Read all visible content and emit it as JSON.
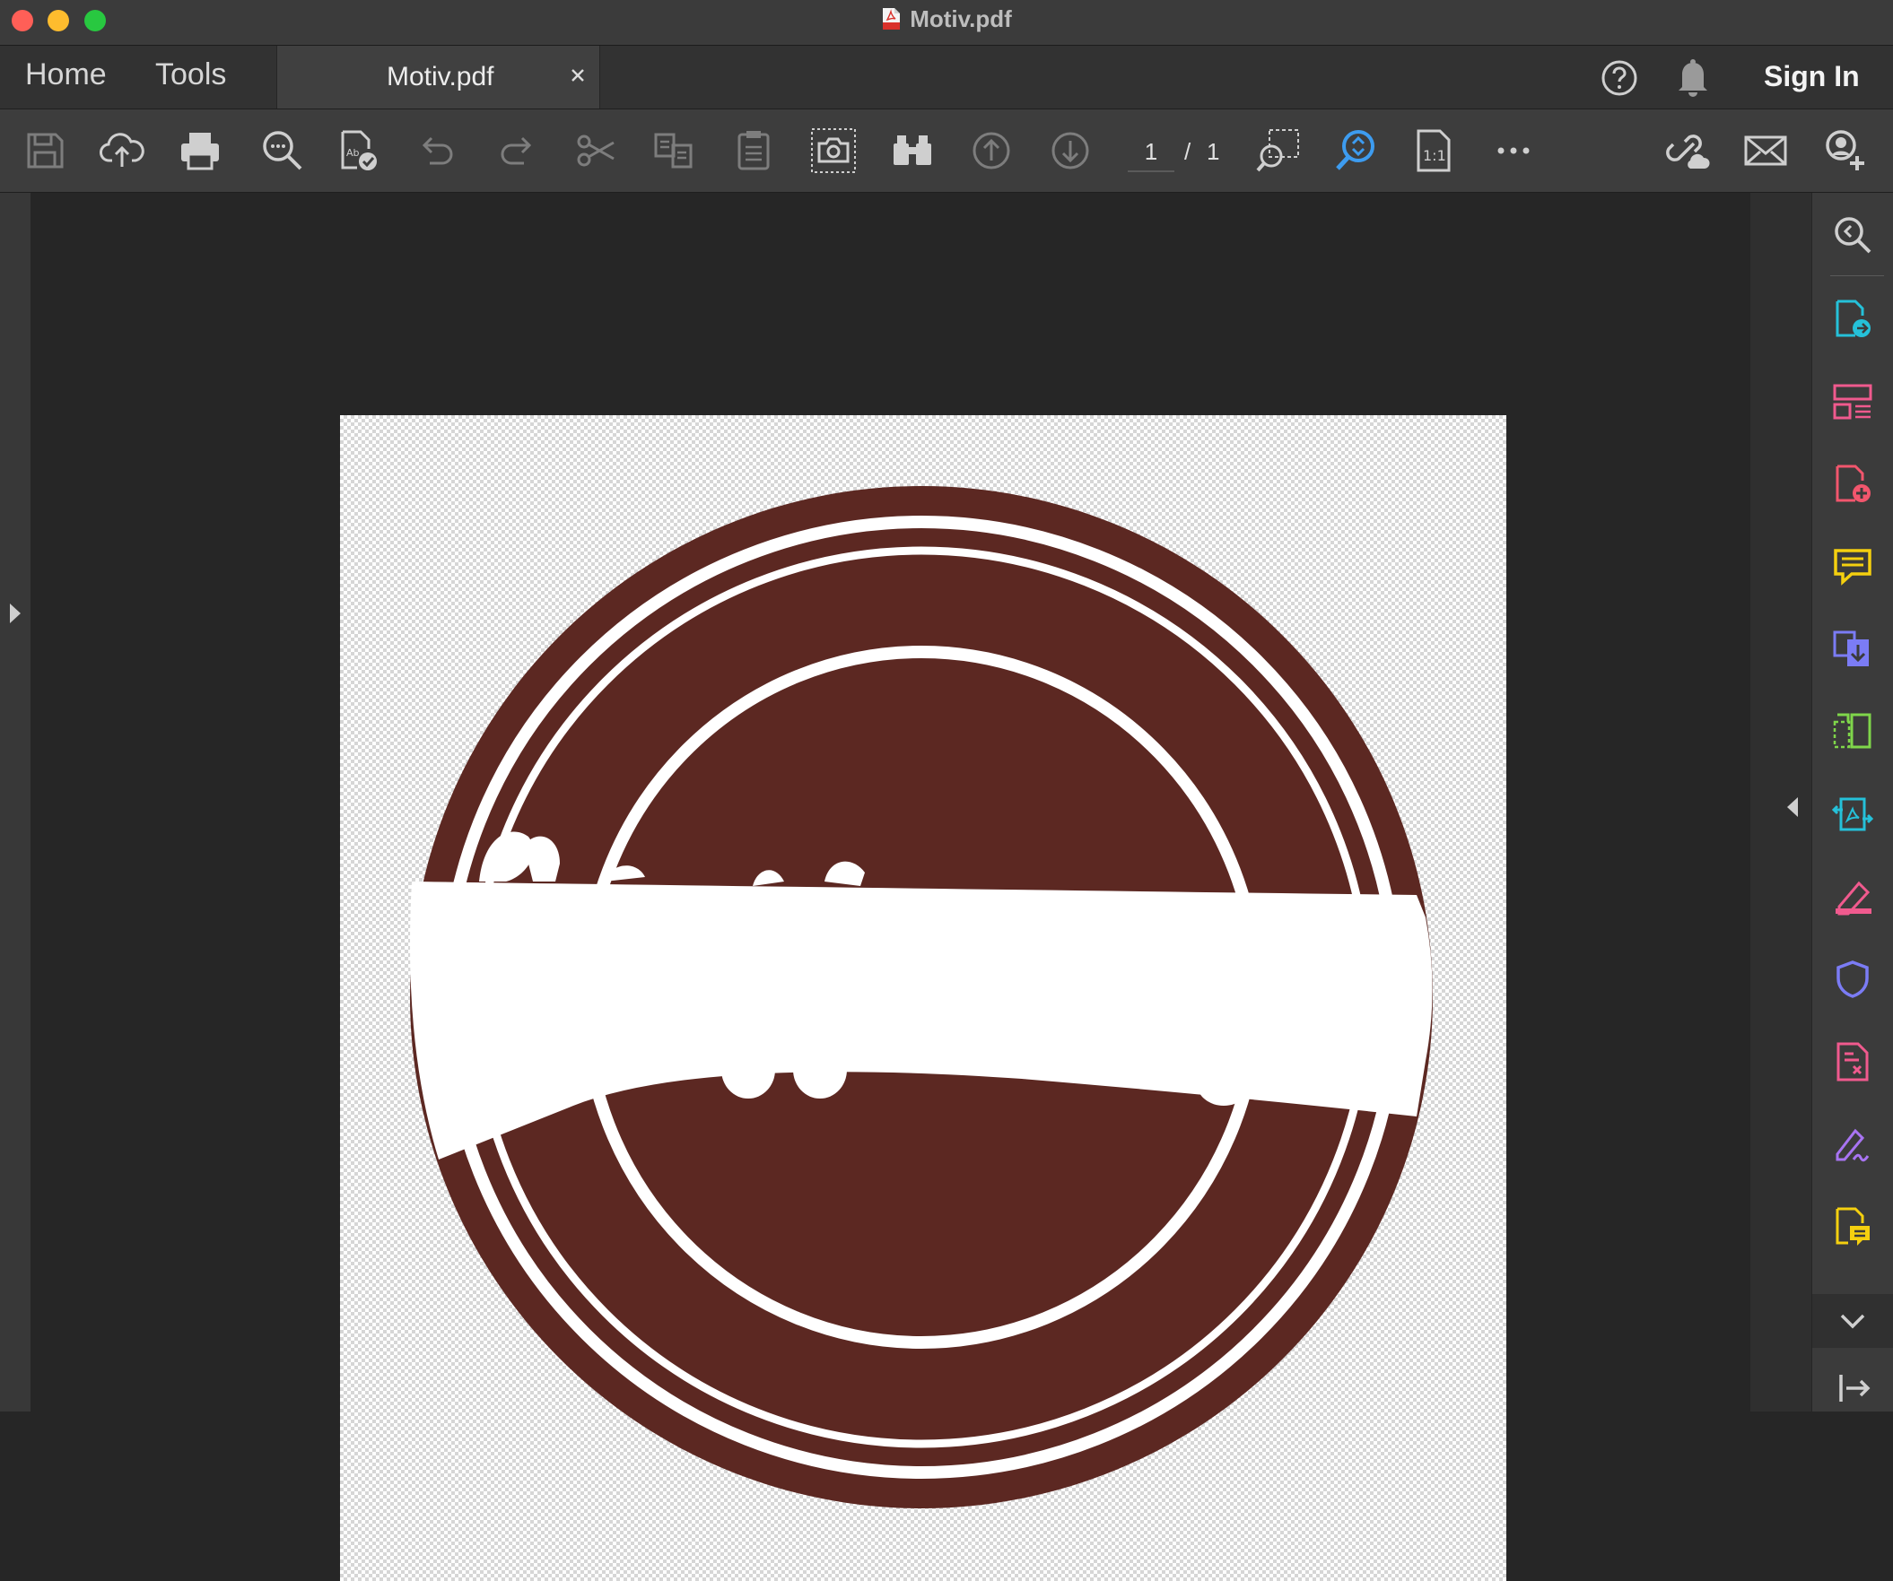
{
  "window": {
    "title": "Motiv.pdf"
  },
  "tabs": {
    "home": "Home",
    "tools": "Tools",
    "document": "Motiv.pdf"
  },
  "header": {
    "sign_in": "Sign In"
  },
  "toolbar": {
    "page_current": "1",
    "page_separator": "/",
    "page_total": "1",
    "icons": [
      "save-icon",
      "upload-cloud-icon",
      "print-icon",
      "find-icon",
      "check-document-icon",
      "undo-icon",
      "redo-icon",
      "cut-icon",
      "copy-format-icon",
      "paste-icon",
      "snapshot-icon",
      "binoculars-icon",
      "previous-page-icon",
      "next-page-icon",
      "marquee-zoom-icon",
      "zoom-tool-icon",
      "actual-size-icon",
      "more-icon",
      "share-link-icon",
      "email-icon",
      "add-user-icon"
    ]
  },
  "right_rail": {
    "icons": [
      "search-zoom-icon",
      "export-pdf-icon",
      "organize-pages-icon",
      "create-pdf-icon",
      "comment-icon",
      "combine-files-icon",
      "compress-pdf-icon",
      "convert-pdf-icon",
      "edit-highlight-icon",
      "protect-icon",
      "redact-icon",
      "fill-sign-icon",
      "notes-icon",
      "expand-icon",
      "collapse-panel-icon"
    ]
  },
  "colors": {
    "accent_blue": "#3d9cf0",
    "logo_brown": "#5c2822",
    "export_teal": "#25c1d9",
    "organize_pink": "#f05a8e",
    "create_red": "#f2566d",
    "comment_yellow": "#f5d00f",
    "combine_purple": "#7b7cf5",
    "compress_green": "#7fd64a",
    "sign_purple": "#a874f2"
  }
}
